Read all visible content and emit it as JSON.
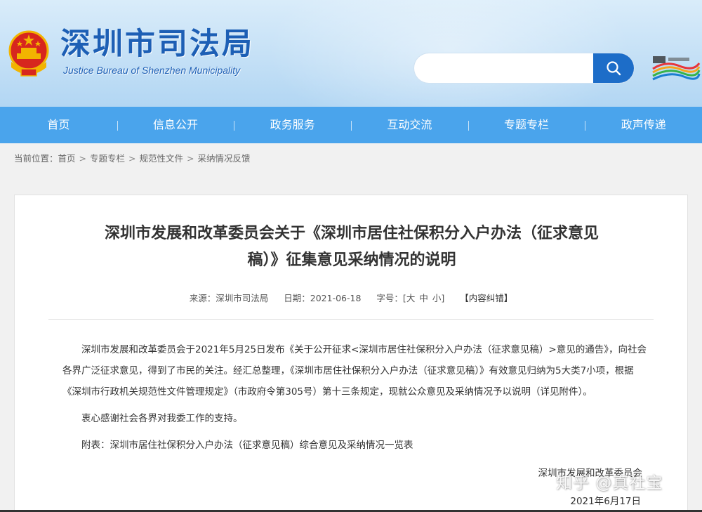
{
  "header": {
    "site_name_cn": "深圳市司法局",
    "site_name_en": "Justice Bureau of Shenzhen Municipality",
    "search": {
      "placeholder": "",
      "value": ""
    },
    "colors": {
      "brand": "#1d5fb5",
      "nav": "#4aa4ec",
      "search_button": "#1d6dc8"
    }
  },
  "nav": {
    "items": [
      {
        "label": "首页"
      },
      {
        "label": "信息公开"
      },
      {
        "label": "政务服务"
      },
      {
        "label": "互动交流"
      },
      {
        "label": "专题专栏"
      },
      {
        "label": "政声传递"
      }
    ]
  },
  "breadcrumb": {
    "prefix": "当前位置：",
    "items": [
      "首页",
      "专题专栏",
      "规范性文件",
      "采纳情况反馈"
    ],
    "separator": ">"
  },
  "article": {
    "title_line1": "深圳市发展和改革委员会关于《深圳市居住社保积分入户办法（征求意见",
    "title_line2": "稿）》征集意见采纳情况的说明",
    "meta": {
      "source_label": "来源：",
      "source_value": "深圳市司法局",
      "date_label": "日期：",
      "date_value": "2021-06-18",
      "size_label": "字号：",
      "size_open": "[",
      "size_large": "大",
      "size_medium": "中",
      "size_small": "小",
      "size_close": "]",
      "error_report": "【内容纠错】"
    },
    "paragraphs": [
      "深圳市发展和改革委员会于2021年5月25日发布《关于公开征求<深圳市居住社保积分入户办法（征求意见稿）>意见的通告》，向社会各界广泛征求意见，得到了市民的关注。经汇总整理，《深圳市居住社保积分入户办法（征求意见稿）》有效意见归纳为5大类7小项，根据《深圳市行政机关规范性文件管理规定》（市政府令第305号）第十三条规定，现就公众意见及采纳情况予以说明（详见附件）。",
      "衷心感谢社会各界对我委工作的支持。",
      "附表：深圳市居住社保积分入户办法（征求意见稿）综合意见及采纳情况一览表"
    ],
    "signature": "深圳市发展和改革委员会",
    "signature_date": "2021年6月17日"
  },
  "watermark": "知乎 @真社宝"
}
